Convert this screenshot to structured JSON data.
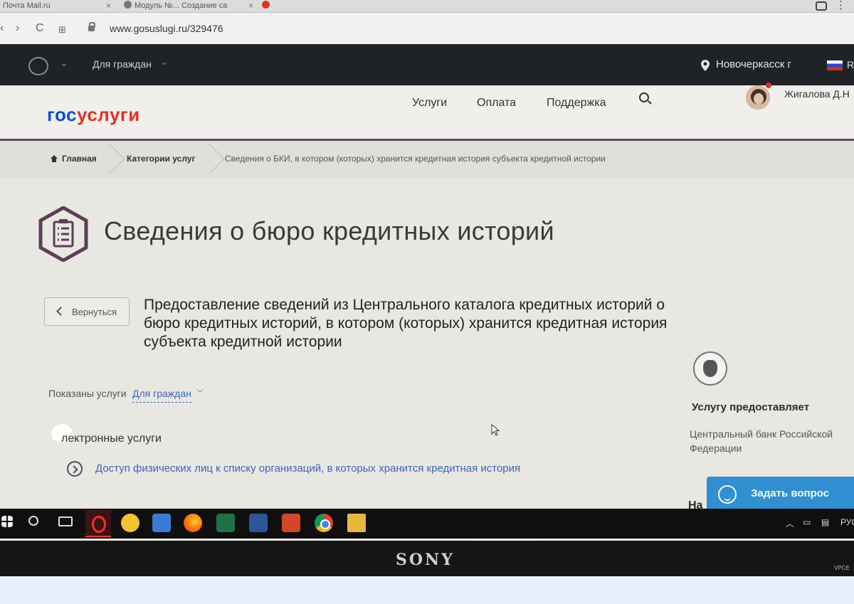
{
  "browser": {
    "tabs": [
      {
        "title": "Почта Mail.ru"
      },
      {
        "title": "Модуль №... Создание са"
      },
      {
        "title": ""
      }
    ],
    "url": "www.gosuslugi.ru/329476"
  },
  "topbar": {
    "audience": "Для граждан",
    "location": "Новочеркасск г",
    "lang": "R"
  },
  "header": {
    "logo_part1": "гос",
    "logo_part2": "услуги",
    "nav": [
      {
        "label": "Услуги"
      },
      {
        "label": "Оплата"
      },
      {
        "label": "Поддержка"
      }
    ],
    "user_name": "Жигалова Д.Н"
  },
  "breadcrumbs": [
    {
      "label": "Главная"
    },
    {
      "label": "Категории услуг"
    },
    {
      "label": "Сведения о БКИ, в котором (которых) хранится кредитная история субъекта кредитной истории"
    }
  ],
  "page": {
    "title": "Сведения о бюро кредитных историй",
    "back_label": "Вернуться",
    "service_title": "Предоставление сведений из Центрального каталога кредитных историй о бюро кредитных историй, в котором (которых) хранится кредитная история субъекта кредитной истории",
    "shown_label": "Показаны услуги",
    "shown_value": "Для граждан",
    "section_title": "лектронные услуги",
    "service_link": "Доступ физических лиц к списку организаций, в которых хранится кредитная история"
  },
  "provider": {
    "heading": "Услугу предоставляет",
    "name": "Центральный банк Российской Федерации",
    "na": "На"
  },
  "chat": {
    "ask_label": "Задать вопрос"
  },
  "taskbar": {
    "tray_lang": "РУС"
  },
  "bezel": {
    "brand": "SONY",
    "model": "VPCE"
  },
  "colors": {
    "logo_blue": "#0d4cd3",
    "logo_red": "#e3311f",
    "link": "#3c66b5",
    "ask_button": "#2f8fd0"
  }
}
